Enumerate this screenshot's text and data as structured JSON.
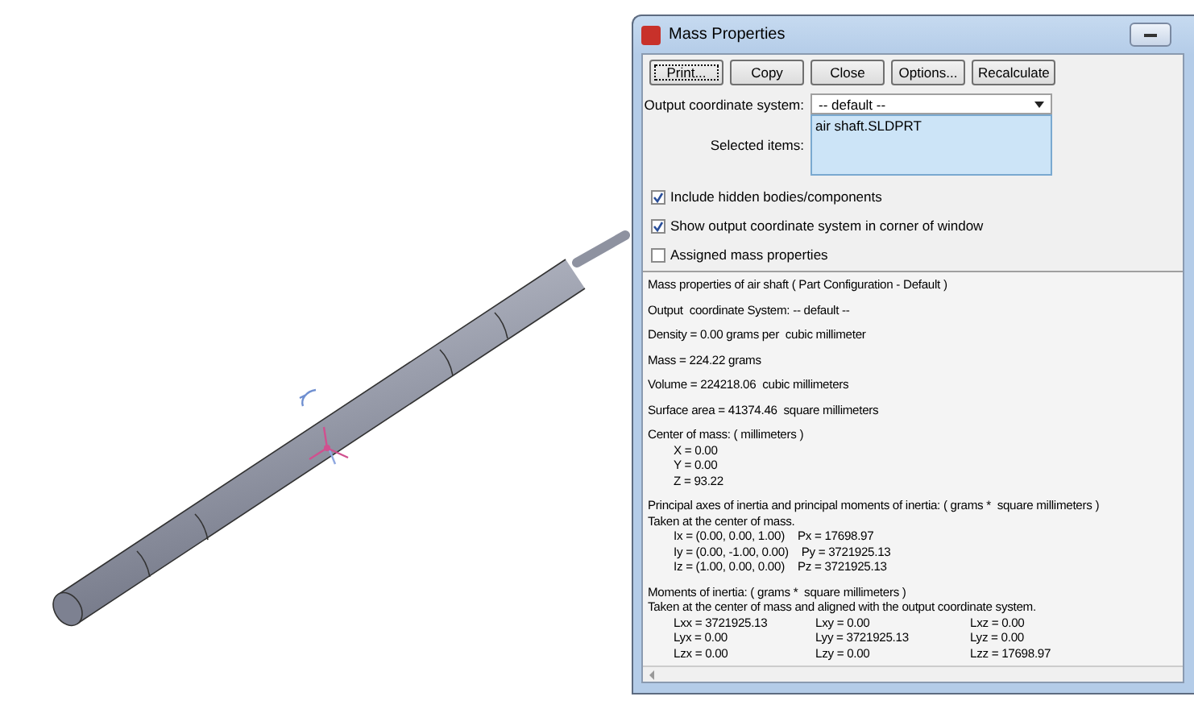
{
  "window": {
    "title": "Mass Properties"
  },
  "buttons": [
    {
      "label": "Print...",
      "focused": true
    },
    {
      "label": "Copy",
      "focused": false
    },
    {
      "label": "Close",
      "focused": false
    },
    {
      "label": "Options...",
      "focused": false
    },
    {
      "label": "Recalculate",
      "focused": false
    }
  ],
  "output_coordinate_system": {
    "label": "Output coordinate system:",
    "value": "-- default --"
  },
  "selected_items": {
    "label": "Selected items:",
    "items": [
      "air shaft.SLDPRT"
    ]
  },
  "options": [
    {
      "label": "Include hidden bodies/components",
      "checked": true
    },
    {
      "label": "Show output coordinate system in corner of window",
      "checked": true
    },
    {
      "label": "Assigned mass properties",
      "checked": false
    }
  ],
  "report": [
    {
      "lines": [
        {
          "kind": "text",
          "cells": [
            "Mass properties of air shaft ( Part Configuration - Default )"
          ]
        }
      ]
    },
    {
      "lines": [
        {
          "kind": "text",
          "cells": [
            "Output  coordinate System: -- default --"
          ]
        }
      ]
    },
    {
      "lines": [
        {
          "kind": "text",
          "cells": [
            "Density = 0.00 grams per  cubic millimeter"
          ]
        }
      ]
    },
    {
      "lines": [
        {
          "kind": "text",
          "cells": [
            "Mass = 224.22 grams"
          ]
        }
      ]
    },
    {
      "lines": [
        {
          "kind": "text",
          "cells": [
            "Volume = 224218.06  cubic millimeters"
          ]
        }
      ]
    },
    {
      "lines": [
        {
          "kind": "text",
          "cells": [
            "Surface area = 41374.46  square millimeters"
          ]
        }
      ]
    },
    {
      "lines": [
        {
          "kind": "text",
          "cells": [
            "Center of mass: ( millimeters )"
          ]
        },
        {
          "kind": "columns",
          "cells": [
            "X = 0.00"
          ]
        },
        {
          "kind": "columns",
          "cells": [
            "Y = 0.00"
          ]
        },
        {
          "kind": "columns",
          "cells": [
            "Z = 93.22"
          ]
        }
      ]
    },
    {
      "lines": [
        {
          "kind": "text",
          "cells": [
            "Principal axes of inertia and principal moments of inertia: ( grams *  square millimeters )"
          ]
        },
        {
          "kind": "text",
          "cells": [
            "Taken at the center of mass."
          ]
        },
        {
          "kind": "columns",
          "cells": [
            "Ix = (0.00, 0.00, 1.00)",
            "Px = 17698.97"
          ]
        },
        {
          "kind": "columns",
          "cells": [
            "Iy = (0.00, -1.00, 0.00)",
            "Py = 3721925.13"
          ]
        },
        {
          "kind": "columns",
          "cells": [
            "Iz = (1.00, 0.00, 0.00)",
            "Pz = 3721925.13"
          ]
        }
      ]
    },
    {
      "lines": [
        {
          "kind": "text",
          "cells": [
            "Moments of inertia: ( grams *  square millimeters )"
          ]
        },
        {
          "kind": "text",
          "cells": [
            "Taken at the center of mass and aligned with the output coordinate system."
          ]
        },
        {
          "kind": "columns",
          "cells": [
            "Lxx = 3721925.13",
            "Lxy = 0.00",
            "Lxz = 0.00"
          ]
        },
        {
          "kind": "columns",
          "cells": [
            "Lyx = 0.00",
            "Lyy = 3721925.13",
            "Lyz = 0.00"
          ]
        },
        {
          "kind": "columns",
          "cells": [
            "Lzx = 0.00",
            "Lzy = 0.00",
            "Lzz = 17698.97"
          ]
        }
      ]
    }
  ]
}
